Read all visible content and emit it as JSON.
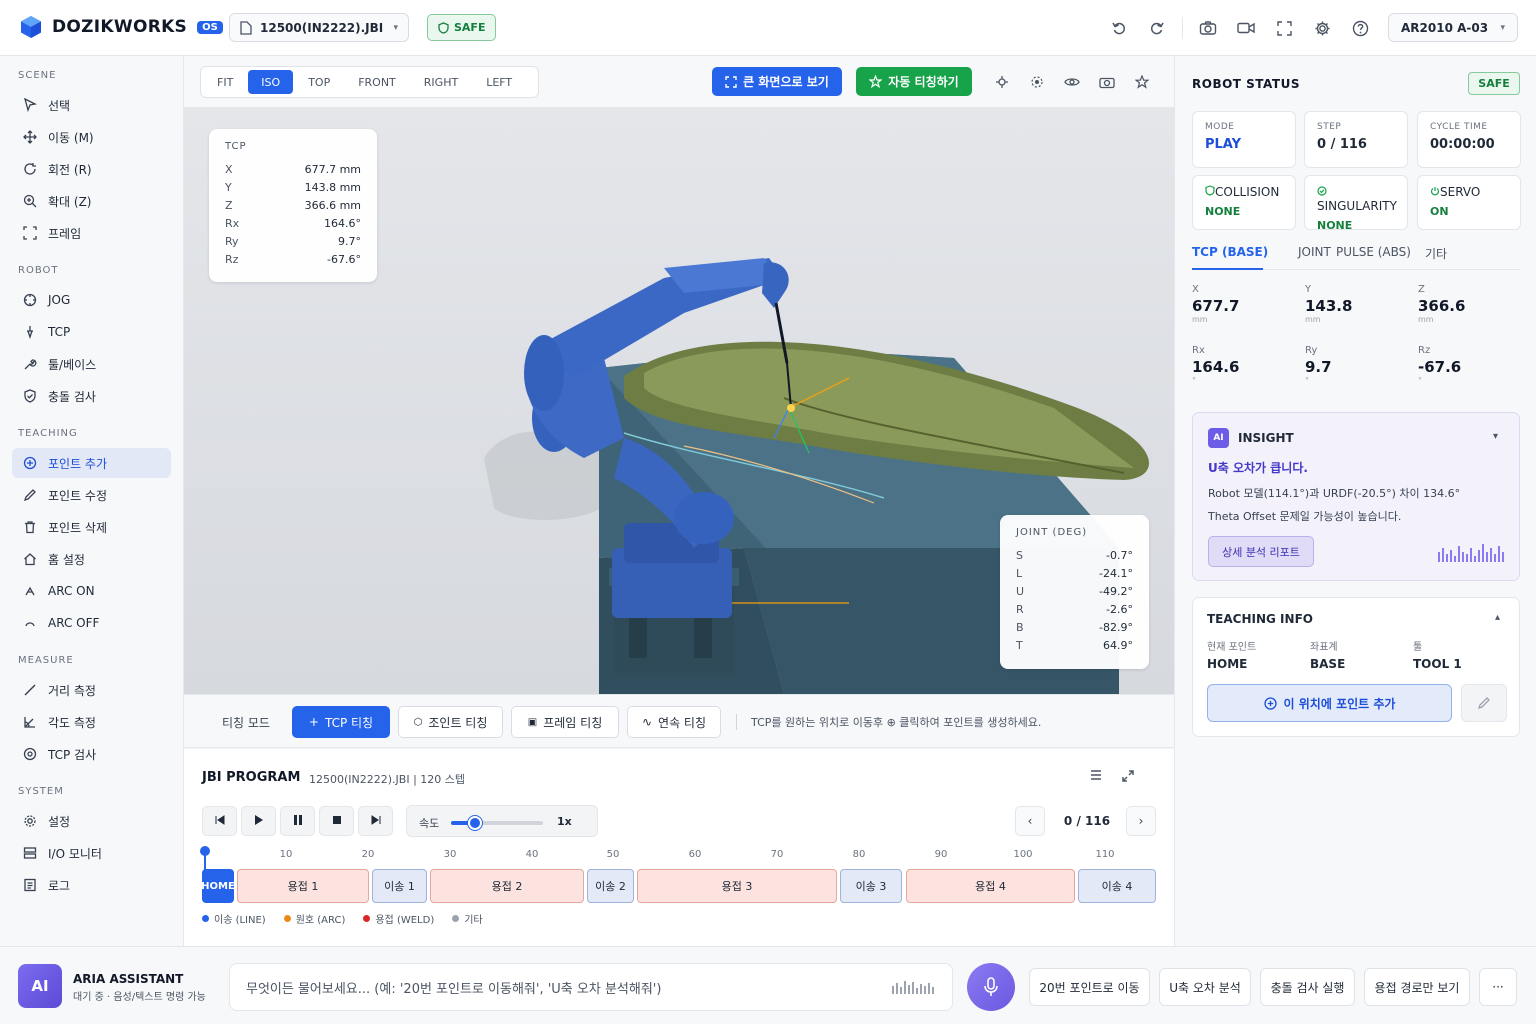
{
  "app": {
    "name": "DOZIKWORKS",
    "badge": "OS",
    "file": "12500(IN2222).JBI",
    "safe": "SAFE",
    "robot": "AR2010 A-03"
  },
  "sidebar": {
    "sections": [
      "SCENE",
      "ROBOT",
      "TEACHING",
      "MEASURE",
      "SYSTEM"
    ],
    "items": [
      "선택",
      "이동 (M)",
      "회전 (R)",
      "확대 (Z)",
      "프레임",
      "JOG",
      "TCP",
      "툴/베이스",
      "충돌 검사",
      "포인트 추가",
      "포인트 수정",
      "포인트 삭제",
      "홈 설정",
      "ARC ON",
      "ARC OFF",
      "거리 측정",
      "각도 측정",
      "TCP 검사",
      "설정",
      "I/O 모니터",
      "로그"
    ]
  },
  "viewport": {
    "view_tabs": [
      "FIT",
      "ISO",
      "TOP",
      "FRONT",
      "RIGHT",
      "LEFT"
    ],
    "active_view": "ISO",
    "fullscreen_btn": "큰 화면으로 보기",
    "auto_teach_btn": "자동 티칭하기",
    "tcp": {
      "title": "TCP",
      "rows": [
        [
          "X",
          "677.7 mm"
        ],
        [
          "Y",
          "143.8 mm"
        ],
        [
          "Z",
          "366.6 mm"
        ],
        [
          "Rx",
          "164.6°"
        ],
        [
          "Ry",
          "9.7°"
        ],
        [
          "Rz",
          "-67.6°"
        ]
      ]
    },
    "joint": {
      "title": "JOINT (DEG)",
      "rows": [
        [
          "S",
          "-0.7°"
        ],
        [
          "L",
          "-24.1°"
        ],
        [
          "U",
          "-49.2°"
        ],
        [
          "R",
          "-2.6°"
        ],
        [
          "B",
          "-82.9°"
        ],
        [
          "T",
          "64.9°"
        ]
      ]
    }
  },
  "teach_mode": {
    "label": "티칭 모드",
    "buttons": [
      "TCP 티칭",
      "조인트 티칭",
      "프레임 티칭",
      "연속 티칭"
    ],
    "hint": "TCP를 원하는 위치로 이동후 ⊕ 클릭하여 포인트를 생성하세요."
  },
  "jbi": {
    "title": "JBI PROGRAM",
    "subtitle": "12500(IN2222).JBI | 120 스텝",
    "speed_label": "속도",
    "speed_value": "1x",
    "speed_fraction": 0.26,
    "step_counter": "0 / 116",
    "ruler": [
      "10",
      "20",
      "30",
      "40",
      "50",
      "60",
      "70",
      "80",
      "90",
      "100",
      "110"
    ],
    "segments": [
      "HOME",
      "용접 1",
      "이송 1",
      "용접 2",
      "이송 2",
      "용접 3",
      "이송 3",
      "용접 4",
      "이송 4"
    ],
    "legend": [
      {
        "label": "이송 (LINE)",
        "color": "#2563eb"
      },
      {
        "label": "원호 (ARC)",
        "color": "#ea8a1a"
      },
      {
        "label": "용접 (WELD)",
        "color": "#dc2626"
      },
      {
        "label": "기타",
        "color": "#9ca3af"
      }
    ]
  },
  "status": {
    "title": "ROBOT STATUS",
    "safe": "SAFE",
    "cards": [
      [
        "MODE",
        "PLAY"
      ],
      [
        "STEP",
        "0 / 116"
      ],
      [
        "CYCLE TIME",
        "00:00:00"
      ]
    ],
    "checks": [
      [
        "COLLISION",
        "NONE"
      ],
      [
        "SINGULARITY",
        "NONE"
      ],
      [
        "SERVO",
        "ON"
      ]
    ],
    "tabs": [
      "TCP (BASE)",
      "JOINT",
      "PULSE (ABS)",
      "기타"
    ],
    "coords": [
      {
        "k": "X",
        "v": "677.7",
        "u": "mm"
      },
      {
        "k": "Y",
        "v": "143.8",
        "u": "mm"
      },
      {
        "k": "Z",
        "v": "366.6",
        "u": "mm"
      },
      {
        "k": "Rx",
        "v": "164.6",
        "u": "°"
      },
      {
        "k": "Ry",
        "v": "9.7",
        "u": "°"
      },
      {
        "k": "Rz",
        "v": "-67.6",
        "u": "°"
      }
    ]
  },
  "insight": {
    "badge": "AI",
    "title": "INSIGHT",
    "headline": "U축 오차가 큽니다.",
    "line1": "Robot 모델(114.1°)과 URDF(-20.5°) 차이 134.6°",
    "line2": "Theta Offset 문제일 가능성이 높습니다.",
    "button": "상세 분석 리포트"
  },
  "teaching_info": {
    "title": "TEACHING INFO",
    "cols": [
      [
        "현재 포인트",
        "HOME"
      ],
      [
        "좌표계",
        "BASE"
      ],
      [
        "툴",
        "TOOL 1"
      ]
    ],
    "add_btn": "이 위치에 포인트 추가"
  },
  "assistant": {
    "avatar": "AI",
    "name": "ARIA ASSISTANT",
    "status": "대기 중 · 음성/텍스트 명령 가능",
    "placeholder": "무엇이든 물어보세요... (예: '20번 포인트로 이동해줘', 'U축 오차 분석해줘')",
    "quick": [
      "20번 포인트로 이동",
      "U축 오차 분석",
      "충돌 검사 실행",
      "용접 경로만 보기"
    ],
    "more": "···"
  }
}
